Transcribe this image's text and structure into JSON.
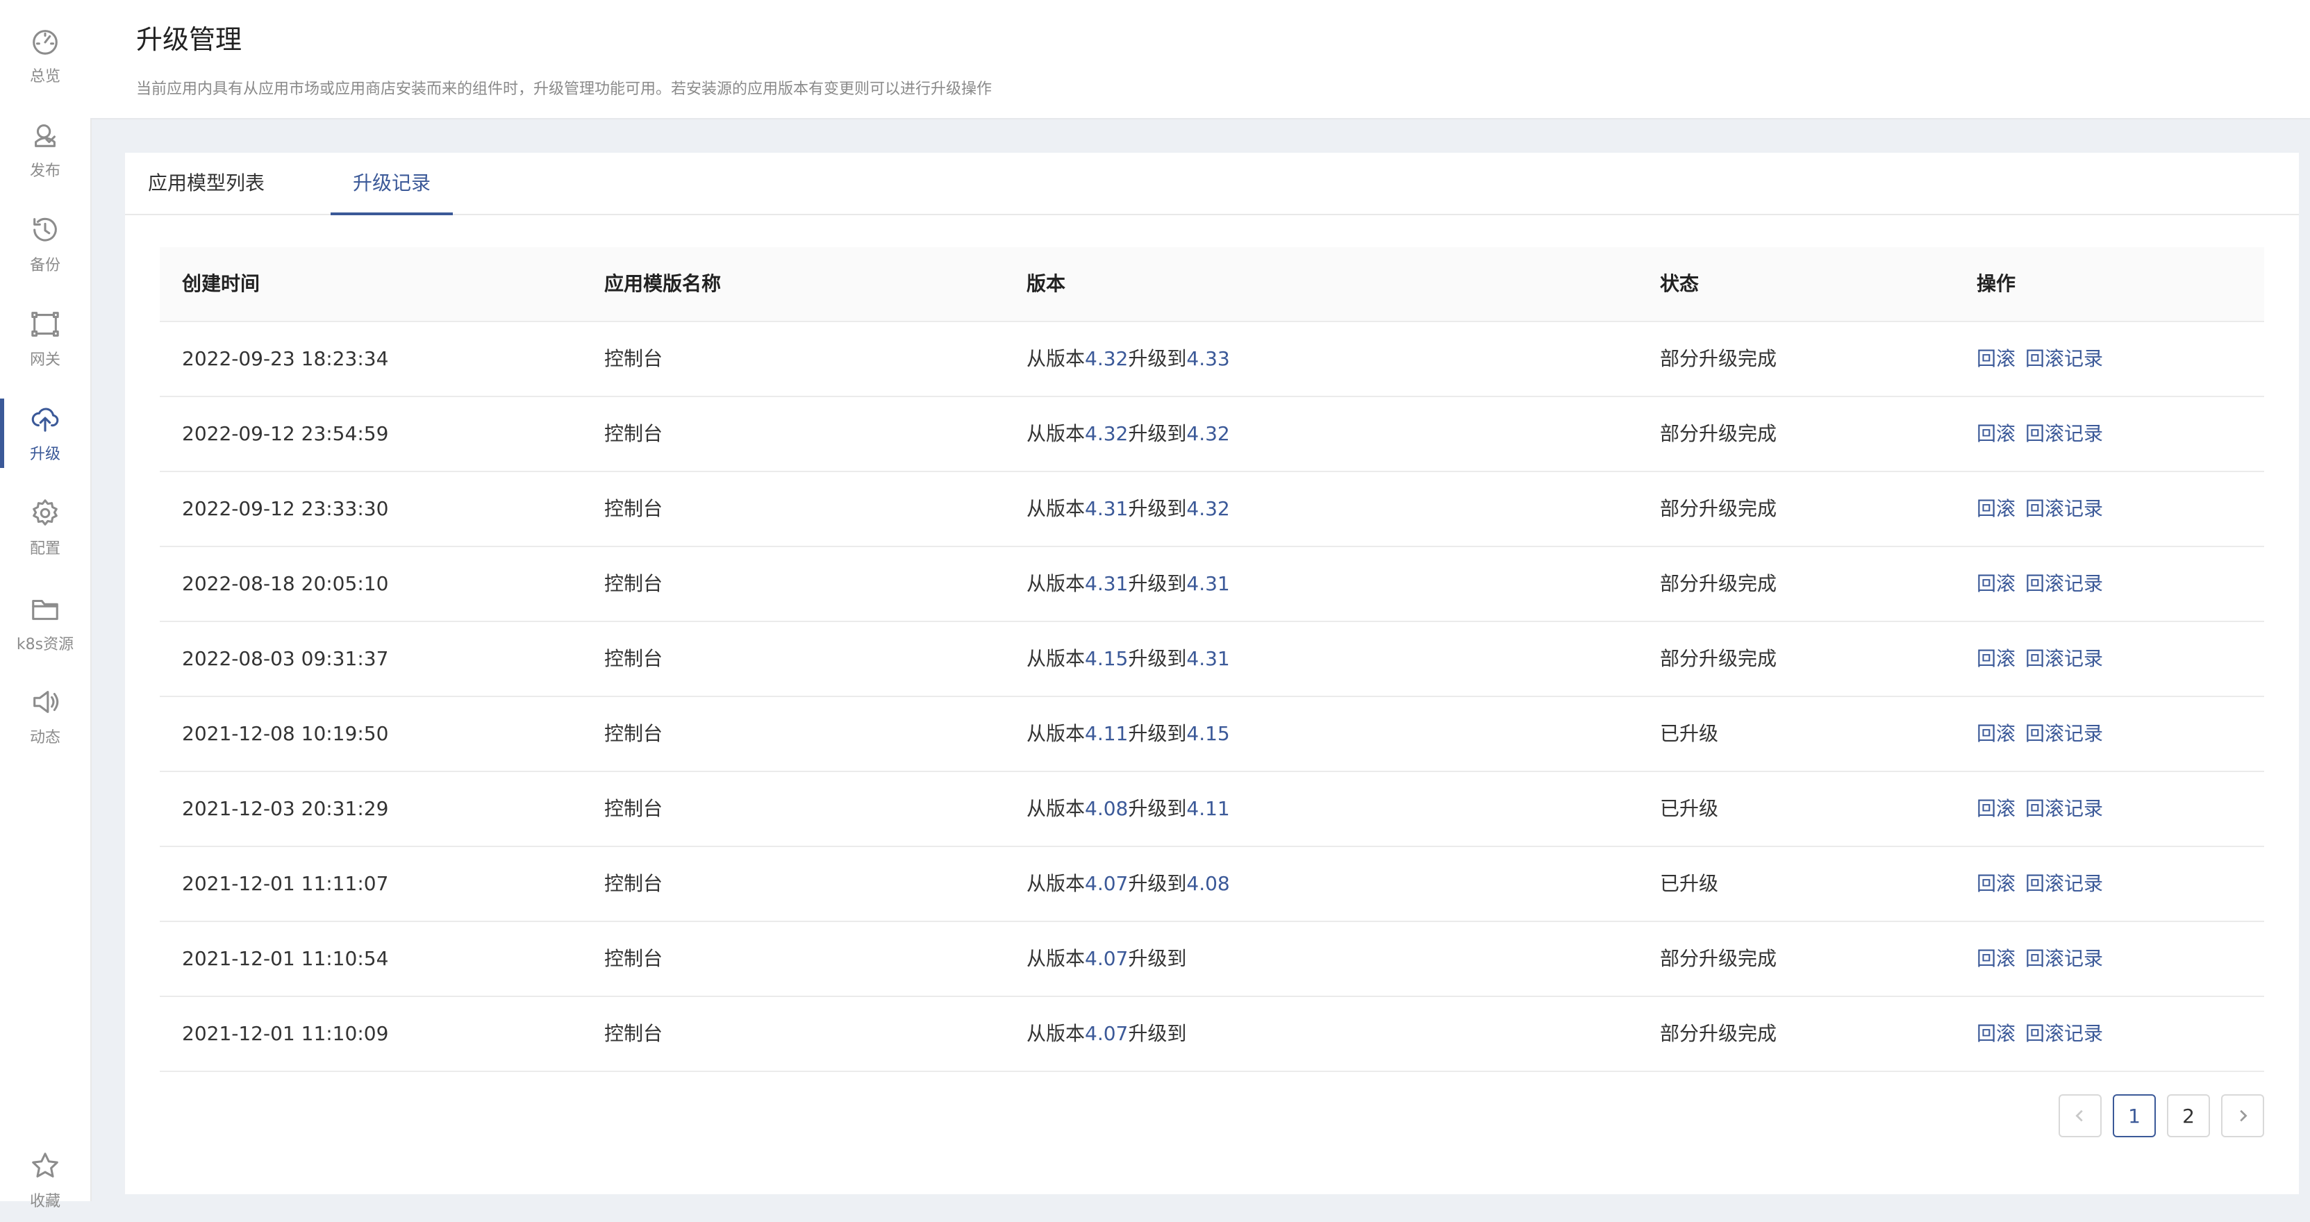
{
  "sidebar": {
    "items": [
      {
        "label": "总览",
        "icon": "dashboard-icon"
      },
      {
        "label": "发布",
        "icon": "publish-icon"
      },
      {
        "label": "备份",
        "icon": "backup-icon"
      },
      {
        "label": "网关",
        "icon": "gateway-icon"
      },
      {
        "label": "升级",
        "icon": "cloud-upload-icon",
        "active": true
      },
      {
        "label": "配置",
        "icon": "gear-icon"
      },
      {
        "label": "k8s资源",
        "icon": "folder-icon"
      },
      {
        "label": "动态",
        "icon": "speaker-icon"
      },
      {
        "label": "收藏",
        "icon": "star-icon"
      }
    ]
  },
  "header": {
    "title": "升级管理",
    "description": "当前应用内具有从应用市场或应用商店安装而来的组件时，升级管理功能可用。若安装源的应用版本有变更则可以进行升级操作"
  },
  "tabs": [
    {
      "label": "应用模型列表",
      "active": false
    },
    {
      "label": "升级记录",
      "active": true
    }
  ],
  "table": {
    "columns": [
      "创建时间",
      "应用模版名称",
      "版本",
      "状态",
      "操作"
    ],
    "rows": [
      {
        "time": "2022-09-23 18:23:34",
        "name": "控制台",
        "from": "4.32",
        "to": "4.33",
        "status": "部分升级完成",
        "actions": [
          "回滚",
          "回滚记录"
        ]
      },
      {
        "time": "2022-09-12 23:54:59",
        "name": "控制台",
        "from": "4.32",
        "to": "4.32",
        "status": "部分升级完成",
        "actions": [
          "回滚",
          "回滚记录"
        ]
      },
      {
        "time": "2022-09-12 23:33:30",
        "name": "控制台",
        "from": "4.31",
        "to": "4.32",
        "status": "部分升级完成",
        "actions": [
          "回滚",
          "回滚记录"
        ]
      },
      {
        "time": "2022-08-18 20:05:10",
        "name": "控制台",
        "from": "4.31",
        "to": "4.31",
        "status": "部分升级完成",
        "actions": [
          "回滚",
          "回滚记录"
        ]
      },
      {
        "time": "2022-08-03 09:31:37",
        "name": "控制台",
        "from": "4.15",
        "to": "4.31",
        "status": "部分升级完成",
        "actions": [
          "回滚",
          "回滚记录"
        ]
      },
      {
        "time": "2021-12-08 10:19:50",
        "name": "控制台",
        "from": "4.11",
        "to": "4.15",
        "status": "已升级",
        "actions": [
          "回滚",
          "回滚记录"
        ]
      },
      {
        "time": "2021-12-03 20:31:29",
        "name": "控制台",
        "from": "4.08",
        "to": "4.11",
        "status": "已升级",
        "actions": [
          "回滚",
          "回滚记录"
        ]
      },
      {
        "time": "2021-12-01 11:11:07",
        "name": "控制台",
        "from": "4.07",
        "to": "4.08",
        "status": "已升级",
        "actions": [
          "回滚",
          "回滚记录"
        ]
      },
      {
        "time": "2021-12-01 11:10:54",
        "name": "控制台",
        "from": "4.07",
        "to": "",
        "status": "部分升级完成",
        "actions": [
          "回滚",
          "回滚记录"
        ]
      },
      {
        "time": "2021-12-01 11:10:09",
        "name": "控制台",
        "from": "4.07",
        "to": "",
        "status": "部分升级完成",
        "actions": [
          "回滚",
          "回滚记录"
        ]
      }
    ],
    "version_prefix": "从版本",
    "version_mid": "升级到"
  },
  "pagination": {
    "pages": [
      "1",
      "2"
    ],
    "current": "1"
  },
  "colors": {
    "accent": "#3b5998"
  }
}
